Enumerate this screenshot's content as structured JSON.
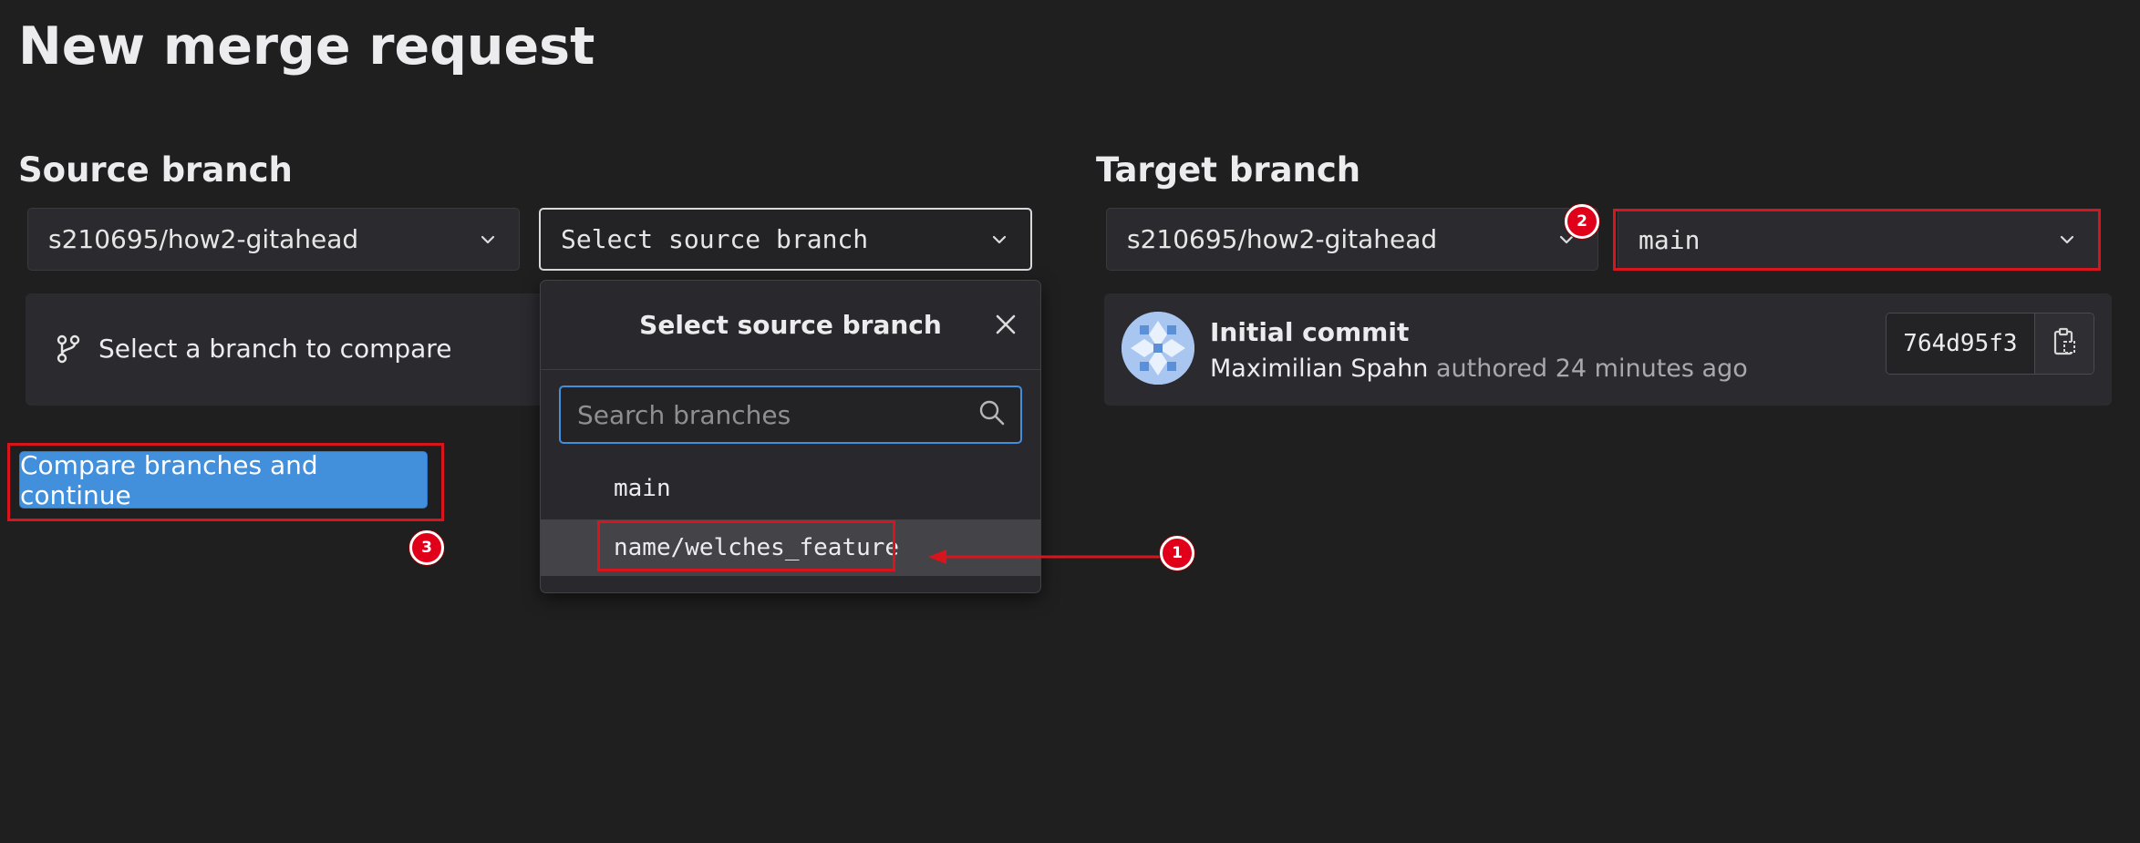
{
  "page": {
    "title": "New merge request"
  },
  "source": {
    "heading": "Source branch",
    "project": "s210695/how2-gitahead",
    "branch_select_label": "Select source branch",
    "compare_hint": "Select a branch to compare",
    "icons": {
      "project_chevron": "chevron-down-icon",
      "branch_chevron": "chevron-down-icon",
      "hint": "git-branch-icon"
    }
  },
  "dropdown_popover": {
    "header": "Select source branch",
    "search_placeholder": "Search branches",
    "branches": [
      {
        "name": "main",
        "selected": false
      },
      {
        "name": "name/welches_feature",
        "selected": true
      }
    ],
    "icons": {
      "close": "close-icon",
      "search": "search-icon"
    }
  },
  "target": {
    "heading": "Target branch",
    "project": "s210695/how2-gitahead",
    "branch": "main",
    "commit": {
      "title": "Initial commit",
      "author": "Maximilian Spahn",
      "authored_text": "authored 24 minutes ago",
      "sha": "764d95f3",
      "icons": {
        "copy": "clipboard-icon",
        "avatar": "avatar"
      }
    }
  },
  "actions": {
    "compare_button": "Compare branches and continue"
  },
  "annotations": {
    "step1": "1",
    "step2": "2",
    "step3": "3",
    "colors": {
      "highlight": "#d8141c",
      "badge": "#e0001a",
      "primary": "#428fdc"
    }
  }
}
